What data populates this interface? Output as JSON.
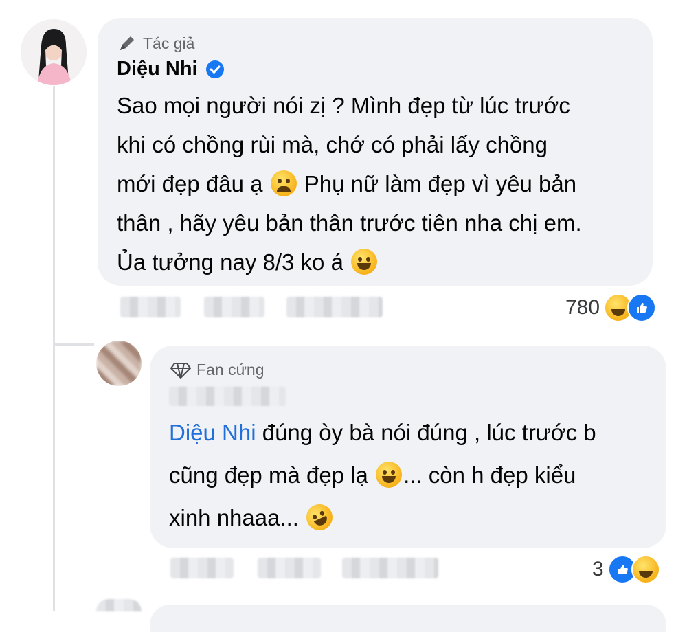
{
  "comment1": {
    "badge": "Tác giả",
    "author": "Diệu Nhi",
    "verified": true,
    "lines": [
      "Sao mọi người nói zị ? Mình đẹp từ lúc trước",
      "khi có chồng rùi mà, chớ có phải lấy chồng",
      "mới đẹp đâu ạ",
      "Phụ nữ làm đẹp vì yêu bản",
      "thân , hãy yêu bản thân trước tiên nha chị em.",
      "Ủa tưởng nay 8/3 ko á"
    ],
    "emojis": [
      "crying-face-emoji",
      "tears-of-joy-emoji"
    ],
    "reaction_count": "780",
    "reactions": [
      "haha",
      "like"
    ]
  },
  "comment2": {
    "badge": "Fan cứng",
    "mention": "Diệu Nhi",
    "lines": [
      " đúng òy bà nói đúng , lúc trước b",
      "cũng đẹp mà đẹp lạ",
      "... còn h đẹp kiểu",
      "xinh nhaaa..."
    ],
    "emojis": [
      "sweat-smile-emoji",
      "rofl-emoji"
    ],
    "reaction_count": "3",
    "reactions": [
      "like",
      "haha"
    ]
  },
  "colors": {
    "bubble": "#f0f2f5",
    "mention": "#216fdb",
    "verified": "#1877f2",
    "meta": "#65676b"
  }
}
